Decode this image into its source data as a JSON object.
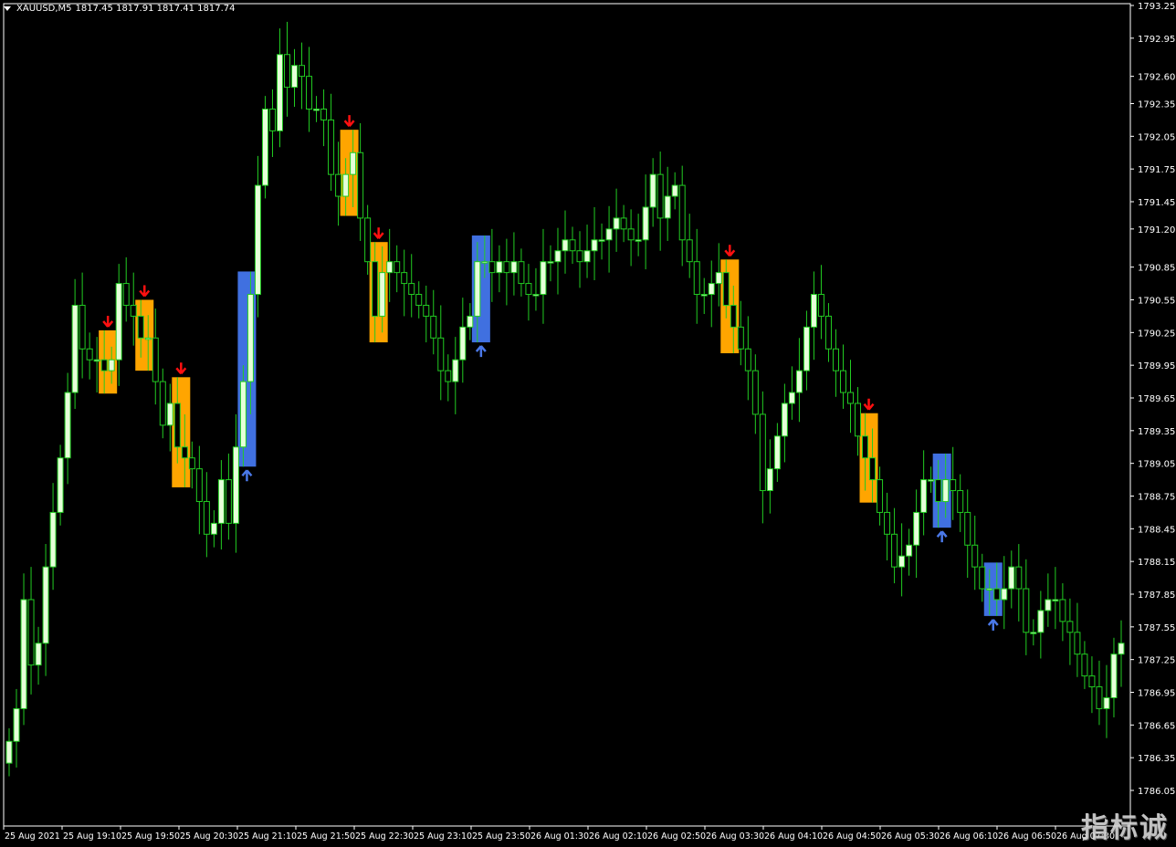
{
  "header": {
    "symbol": "XAUUSD,M5",
    "ohlc": "1817.45 1817.91 1817.41 1817.74"
  },
  "watermark": "指标诚",
  "colors": {
    "background": "#000000",
    "frame": "#ffffff",
    "bull_candle": "#e6ffd9",
    "bear_candle": "#000000",
    "wick": "#22cc22",
    "sell_zone": "#ffa500",
    "buy_zone": "#4070e0",
    "sell_arrow": "#ff1010",
    "buy_arrow": "#4a78e8"
  },
  "chart_data": {
    "type": "candlestick",
    "ylim": [
      1786.05,
      1793.25
    ],
    "y_ticks": [
      "1793.25",
      "1792.95",
      "1792.60",
      "1792.35",
      "1792.05",
      "1791.75",
      "1791.45",
      "1791.20",
      "1790.85",
      "1790.55",
      "1790.25",
      "1789.95",
      "1789.65",
      "1789.35",
      "1789.05",
      "1788.75",
      "1788.45",
      "1788.15",
      "1787.85",
      "1787.55",
      "1787.25",
      "1786.95",
      "1786.65",
      "1786.35",
      "1786.05"
    ],
    "x_ticks": [
      "25 Aug 2021",
      "25 Aug 19:10",
      "25 Aug 19:50",
      "25 Aug 20:30",
      "25 Aug 21:10",
      "25 Aug 21:50",
      "25 Aug 22:30",
      "25 Aug 23:10",
      "25 Aug 23:50",
      "26 Aug 01:30",
      "26 Aug 02:10",
      "26 Aug 02:50",
      "26 Aug 03:30",
      "26 Aug 04:10",
      "26 Aug 04:50",
      "26 Aug 05:30",
      "26 Aug 06:10",
      "26 Aug 06:50",
      "26 Aug 07:30"
    ],
    "candle_spacing_bars": 1,
    "closes": [
      1786.5,
      1786.8,
      1787.8,
      1787.2,
      1787.4,
      1788.1,
      1788.6,
      1789.1,
      1789.7,
      1790.5,
      1790.1,
      1790.0,
      1790.0,
      1789.9,
      1790.0,
      1790.7,
      1790.5,
      1790.4,
      1790.2,
      1790.2,
      1789.8,
      1789.4,
      1789.6,
      1789.2,
      1789.1,
      1789.0,
      1788.7,
      1788.4,
      1788.5,
      1788.9,
      1788.5,
      1789.2,
      1789.8,
      1790.6,
      1791.6,
      1792.3,
      1792.1,
      1792.8,
      1792.5,
      1792.7,
      1792.6,
      1792.3,
      1792.3,
      1792.2,
      1791.7,
      1791.5,
      1791.7,
      1791.9,
      1791.3,
      1790.9,
      1790.4,
      1790.8,
      1790.9,
      1790.8,
      1790.7,
      1790.6,
      1790.5,
      1790.4,
      1790.2,
      1789.9,
      1789.8,
      1790.0,
      1790.3,
      1790.4,
      1790.9,
      1790.9,
      1790.8,
      1790.9,
      1790.8,
      1790.9,
      1790.7,
      1790.6,
      1790.6,
      1790.9,
      1790.9,
      1791.0,
      1791.1,
      1791.0,
      1790.9,
      1791.0,
      1791.1,
      1791.1,
      1791.2,
      1791.3,
      1791.2,
      1791.1,
      1791.1,
      1791.4,
      1791.7,
      1791.3,
      1791.5,
      1791.6,
      1791.1,
      1790.9,
      1790.6,
      1790.6,
      1790.7,
      1790.8,
      1790.5,
      1790.3,
      1790.1,
      1789.9,
      1789.5,
      1788.8,
      1789.0,
      1789.3,
      1789.6,
      1789.7,
      1789.9,
      1790.3,
      1790.6,
      1790.4,
      1790.1,
      1789.9,
      1789.7,
      1789.6,
      1789.3,
      1789.1,
      1788.9,
      1788.6,
      1788.4,
      1788.1,
      1788.2,
      1788.3,
      1788.6,
      1788.9,
      1788.9,
      1788.7,
      1788.9,
      1788.8,
      1788.6,
      1788.3,
      1788.1,
      1787.9,
      1787.9,
      1787.8,
      1787.9,
      1788.1,
      1787.9,
      1787.5,
      1787.5,
      1787.7,
      1787.8,
      1787.8,
      1787.6,
      1787.5,
      1787.3,
      1787.1,
      1787.0,
      1786.8,
      1786.9,
      1787.3,
      1787.4
    ]
  }
}
